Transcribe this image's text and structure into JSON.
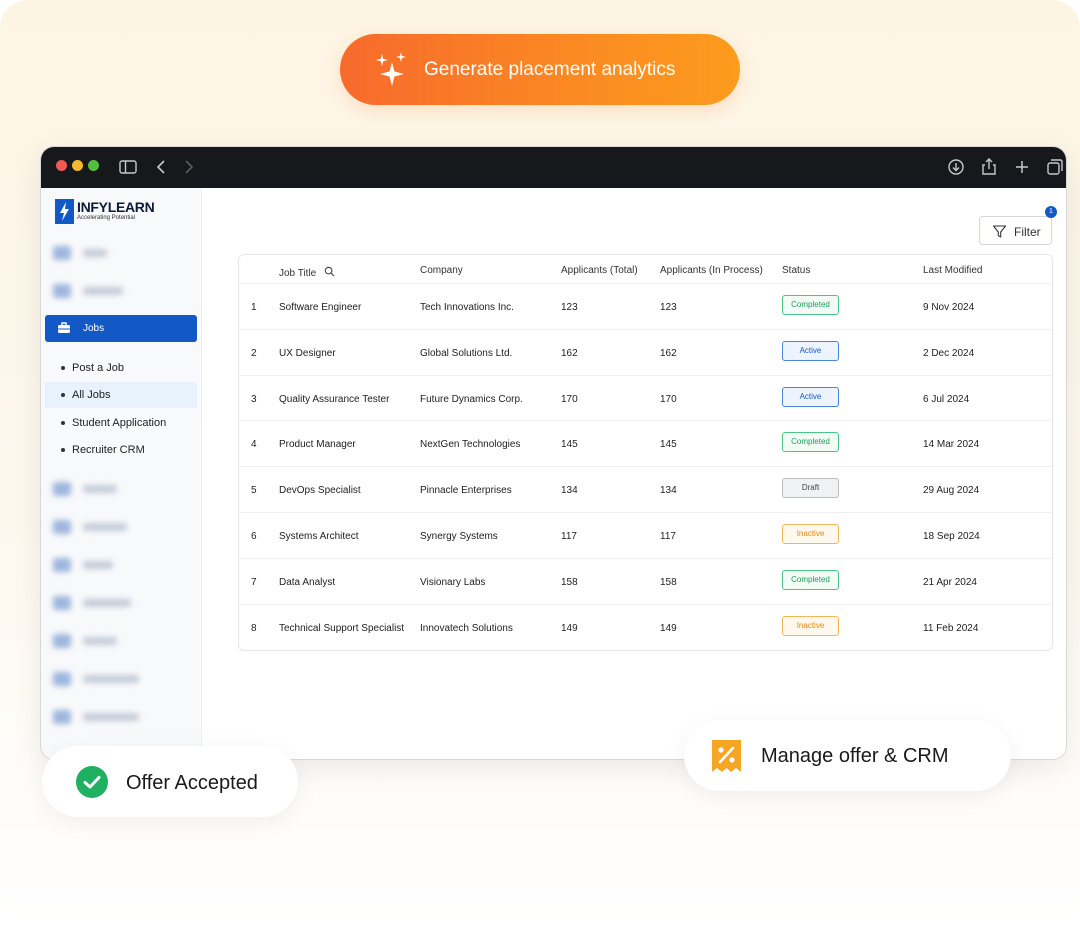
{
  "cta": {
    "label": "Generate placement analytics"
  },
  "sidebar": {
    "logo": {
      "name": "INFYLEARN",
      "tagline": "Accelerating Potential"
    },
    "jobs_label": "Jobs",
    "sub_items": [
      {
        "label": "Post a Job",
        "active": false
      },
      {
        "label": "All Jobs",
        "active": true
      },
      {
        "label": "Student Application",
        "active": false
      },
      {
        "label": "Recruiter CRM",
        "active": false
      }
    ]
  },
  "toolbar": {
    "filter_label": "Filter",
    "filter_count": "1"
  },
  "table": {
    "headers": {
      "job_title": "Job Title",
      "company": "Company",
      "applicants_total": "Applicants (Total)",
      "applicants_in_process": "Applicants (In Process)",
      "status": "Status",
      "last_modified": "Last Modified"
    },
    "rows": [
      {
        "index": "1",
        "title": "Software Engineer",
        "company": "Tech Innovations Inc.",
        "total": "123",
        "in_process": "123",
        "status": "Completed",
        "status_kind": "completed",
        "modified": "9 Nov 2024"
      },
      {
        "index": "2",
        "title": "UX Designer",
        "company": "Global Solutions Ltd.",
        "total": "162",
        "in_process": "162",
        "status": "Active",
        "status_kind": "active",
        "modified": "2 Dec 2024"
      },
      {
        "index": "3",
        "title": "Quality Assurance Tester",
        "company": "Future Dynamics Corp.",
        "total": "170",
        "in_process": "170",
        "status": "Active",
        "status_kind": "active",
        "modified": "6 Jul 2024"
      },
      {
        "index": "4",
        "title": "Product Manager",
        "company": "NextGen Technologies",
        "total": "145",
        "in_process": "145",
        "status": "Completed",
        "status_kind": "completed",
        "modified": "14 Mar 2024"
      },
      {
        "index": "5",
        "title": "DevOps Specialist",
        "company": "Pinnacle Enterprises",
        "total": "134",
        "in_process": "134",
        "status": "Draft",
        "status_kind": "draft",
        "modified": "29 Aug 2024"
      },
      {
        "index": "6",
        "title": "Systems Architect",
        "company": "Synergy Systems",
        "total": "117",
        "in_process": "117",
        "status": "Inactive",
        "status_kind": "inactive",
        "modified": "18 Sep 2024"
      },
      {
        "index": "7",
        "title": "Data Analyst",
        "company": "Visionary Labs",
        "total": "158",
        "in_process": "158",
        "status": "Completed",
        "status_kind": "completed",
        "modified": "21 Apr 2024"
      },
      {
        "index": "8",
        "title": "Technical Support Specialist",
        "company": "Innovatech Solutions",
        "total": "149",
        "in_process": "149",
        "status": "Inactive",
        "status_kind": "inactive",
        "modified": "11 Feb 2024"
      }
    ]
  },
  "badges": {
    "offer": {
      "label": "Offer Accepted",
      "icon": "check-circle-icon"
    },
    "crm": {
      "label": "Manage offer & CRM",
      "icon": "discount-tag-icon"
    }
  },
  "colors": {
    "accent": "#1359c5",
    "cta_start": "#f76a2c",
    "cta_end": "#fd9c1d",
    "success": "#1fb061",
    "crm_icon": "#f5a623"
  }
}
